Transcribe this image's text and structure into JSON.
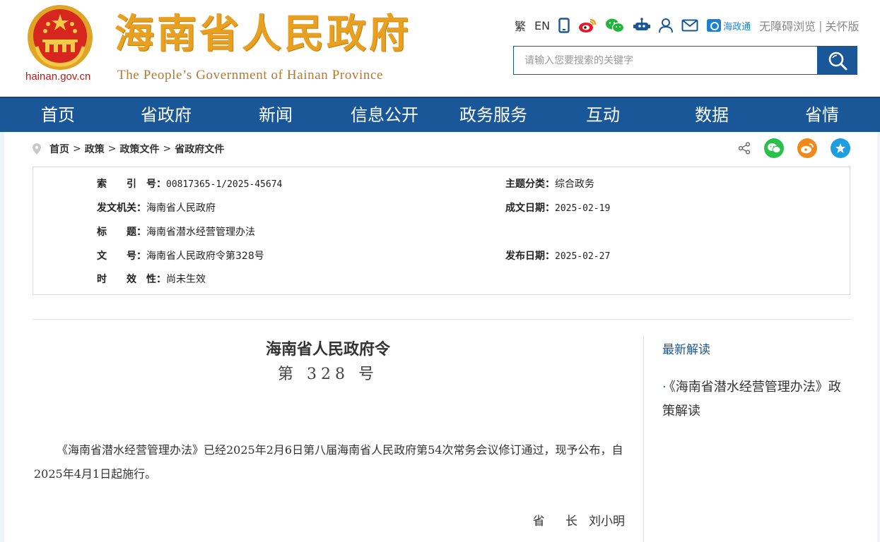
{
  "header": {
    "domain": "hainan.gov.cn",
    "title": "海南省人民政府",
    "subtitle": "The People’s Government  of Hainan Province",
    "top_links": {
      "traditional": "繁",
      "english": "EN",
      "hzt": "海政通",
      "accessible": "无障碍浏览",
      "separator": "|",
      "elderly": "关怀版"
    },
    "search": {
      "placeholder": "请输入您要搜索的关键字"
    }
  },
  "nav": {
    "items": [
      "首页",
      "省政府",
      "新闻",
      "信息公开",
      "政务服务",
      "互动",
      "数据",
      "省情"
    ]
  },
  "breadcrumb": {
    "items": [
      "首页",
      "政策",
      "政策文件",
      "省政府文件"
    ],
    "separator": ">"
  },
  "meta": {
    "index_label": "索　　引　号：",
    "index_value": "00817365-1/2025-45674",
    "topic_label": "主题分类：",
    "topic_value": "综合政务",
    "issuer_label": "发文机关：",
    "issuer_value": "海南省人民政府",
    "date_written_label": "成文日期：",
    "date_written_value": "2025-02-19",
    "title_label": "标　　题：",
    "title_value": "海南省潜水经营管理办法",
    "doc_no_label": "文　　号：",
    "doc_no_value": "海南省人民政府令第328号",
    "publish_date_label": "发布日期：",
    "publish_date_value": "2025-02-27",
    "validity_label": "时　　效　性：",
    "validity_value": "尚未生效"
  },
  "document": {
    "title": "海南省人民政府令",
    "number": "第 328 号",
    "body": "《海南省潜水经营管理办法》已经2025年2月6日第八届海南省人民政府第54次常务会议修订通过，现予公布，自2025年4月1日起施行。",
    "signature_label": "省 长",
    "signature_name": "刘小明"
  },
  "sidebar": {
    "title": "最新解读",
    "items": [
      {
        "label": "《海南省潜水经营管理办法》政策解读"
      }
    ]
  },
  "colors": {
    "primary": "#1a5799",
    "title_gold": "#e8a020",
    "emblem_red": "#d7261e"
  }
}
